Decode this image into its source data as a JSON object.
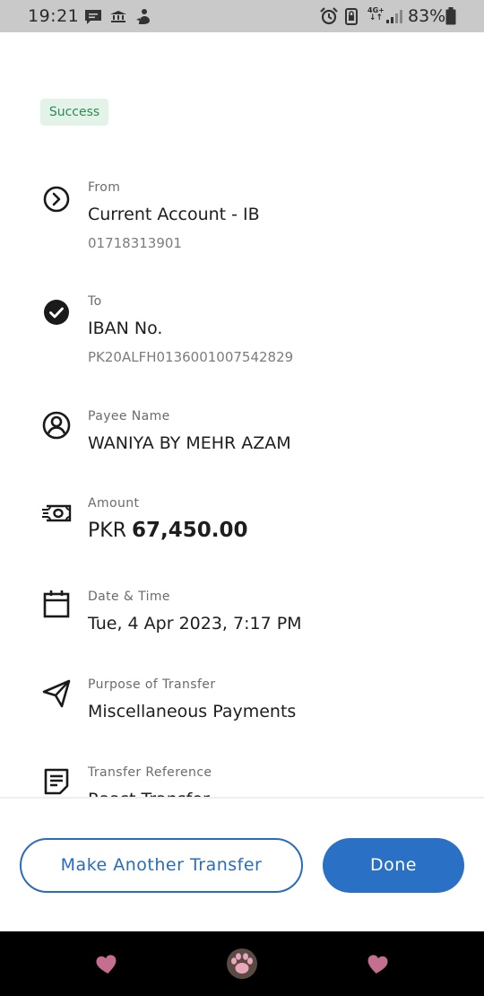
{
  "status_bar": {
    "time": "19:21",
    "network": "4G+",
    "battery": "83%"
  },
  "status": {
    "badge": "Success",
    "badge_color": "#2e8a4f"
  },
  "details": {
    "from": {
      "label": "From",
      "value": "Current Account - IB",
      "sub": "01718313901",
      "icon": "chevron-right-circle-icon"
    },
    "to": {
      "label": "To",
      "value": "IBAN No.",
      "sub": "PK20ALFH0136001007542829",
      "icon": "check-circle-icon"
    },
    "payee": {
      "label": "Payee Name",
      "value": "WANIYA BY MEHR AZAM",
      "icon": "user-circle-icon"
    },
    "amount": {
      "label": "Amount",
      "currency": "PKR",
      "value": "67,450.00",
      "icon": "money-icon"
    },
    "datetime": {
      "label": "Date & Time",
      "value": "Tue, 4 Apr 2023, 7:17 PM",
      "icon": "calendar-icon"
    },
    "purpose": {
      "label": "Purpose of Transfer",
      "value": "Miscellaneous Payments",
      "icon": "send-icon"
    },
    "reference": {
      "label": "Transfer Reference",
      "value": "Raast Transfer",
      "icon": "document-icon"
    }
  },
  "actions": {
    "another": "Make Another Transfer",
    "done": "Done",
    "accent": "#2a70c4"
  },
  "nav_bar": {
    "left_icon": "heart-icon",
    "center_icon": "paw-icon",
    "right_icon": "heart-icon"
  }
}
